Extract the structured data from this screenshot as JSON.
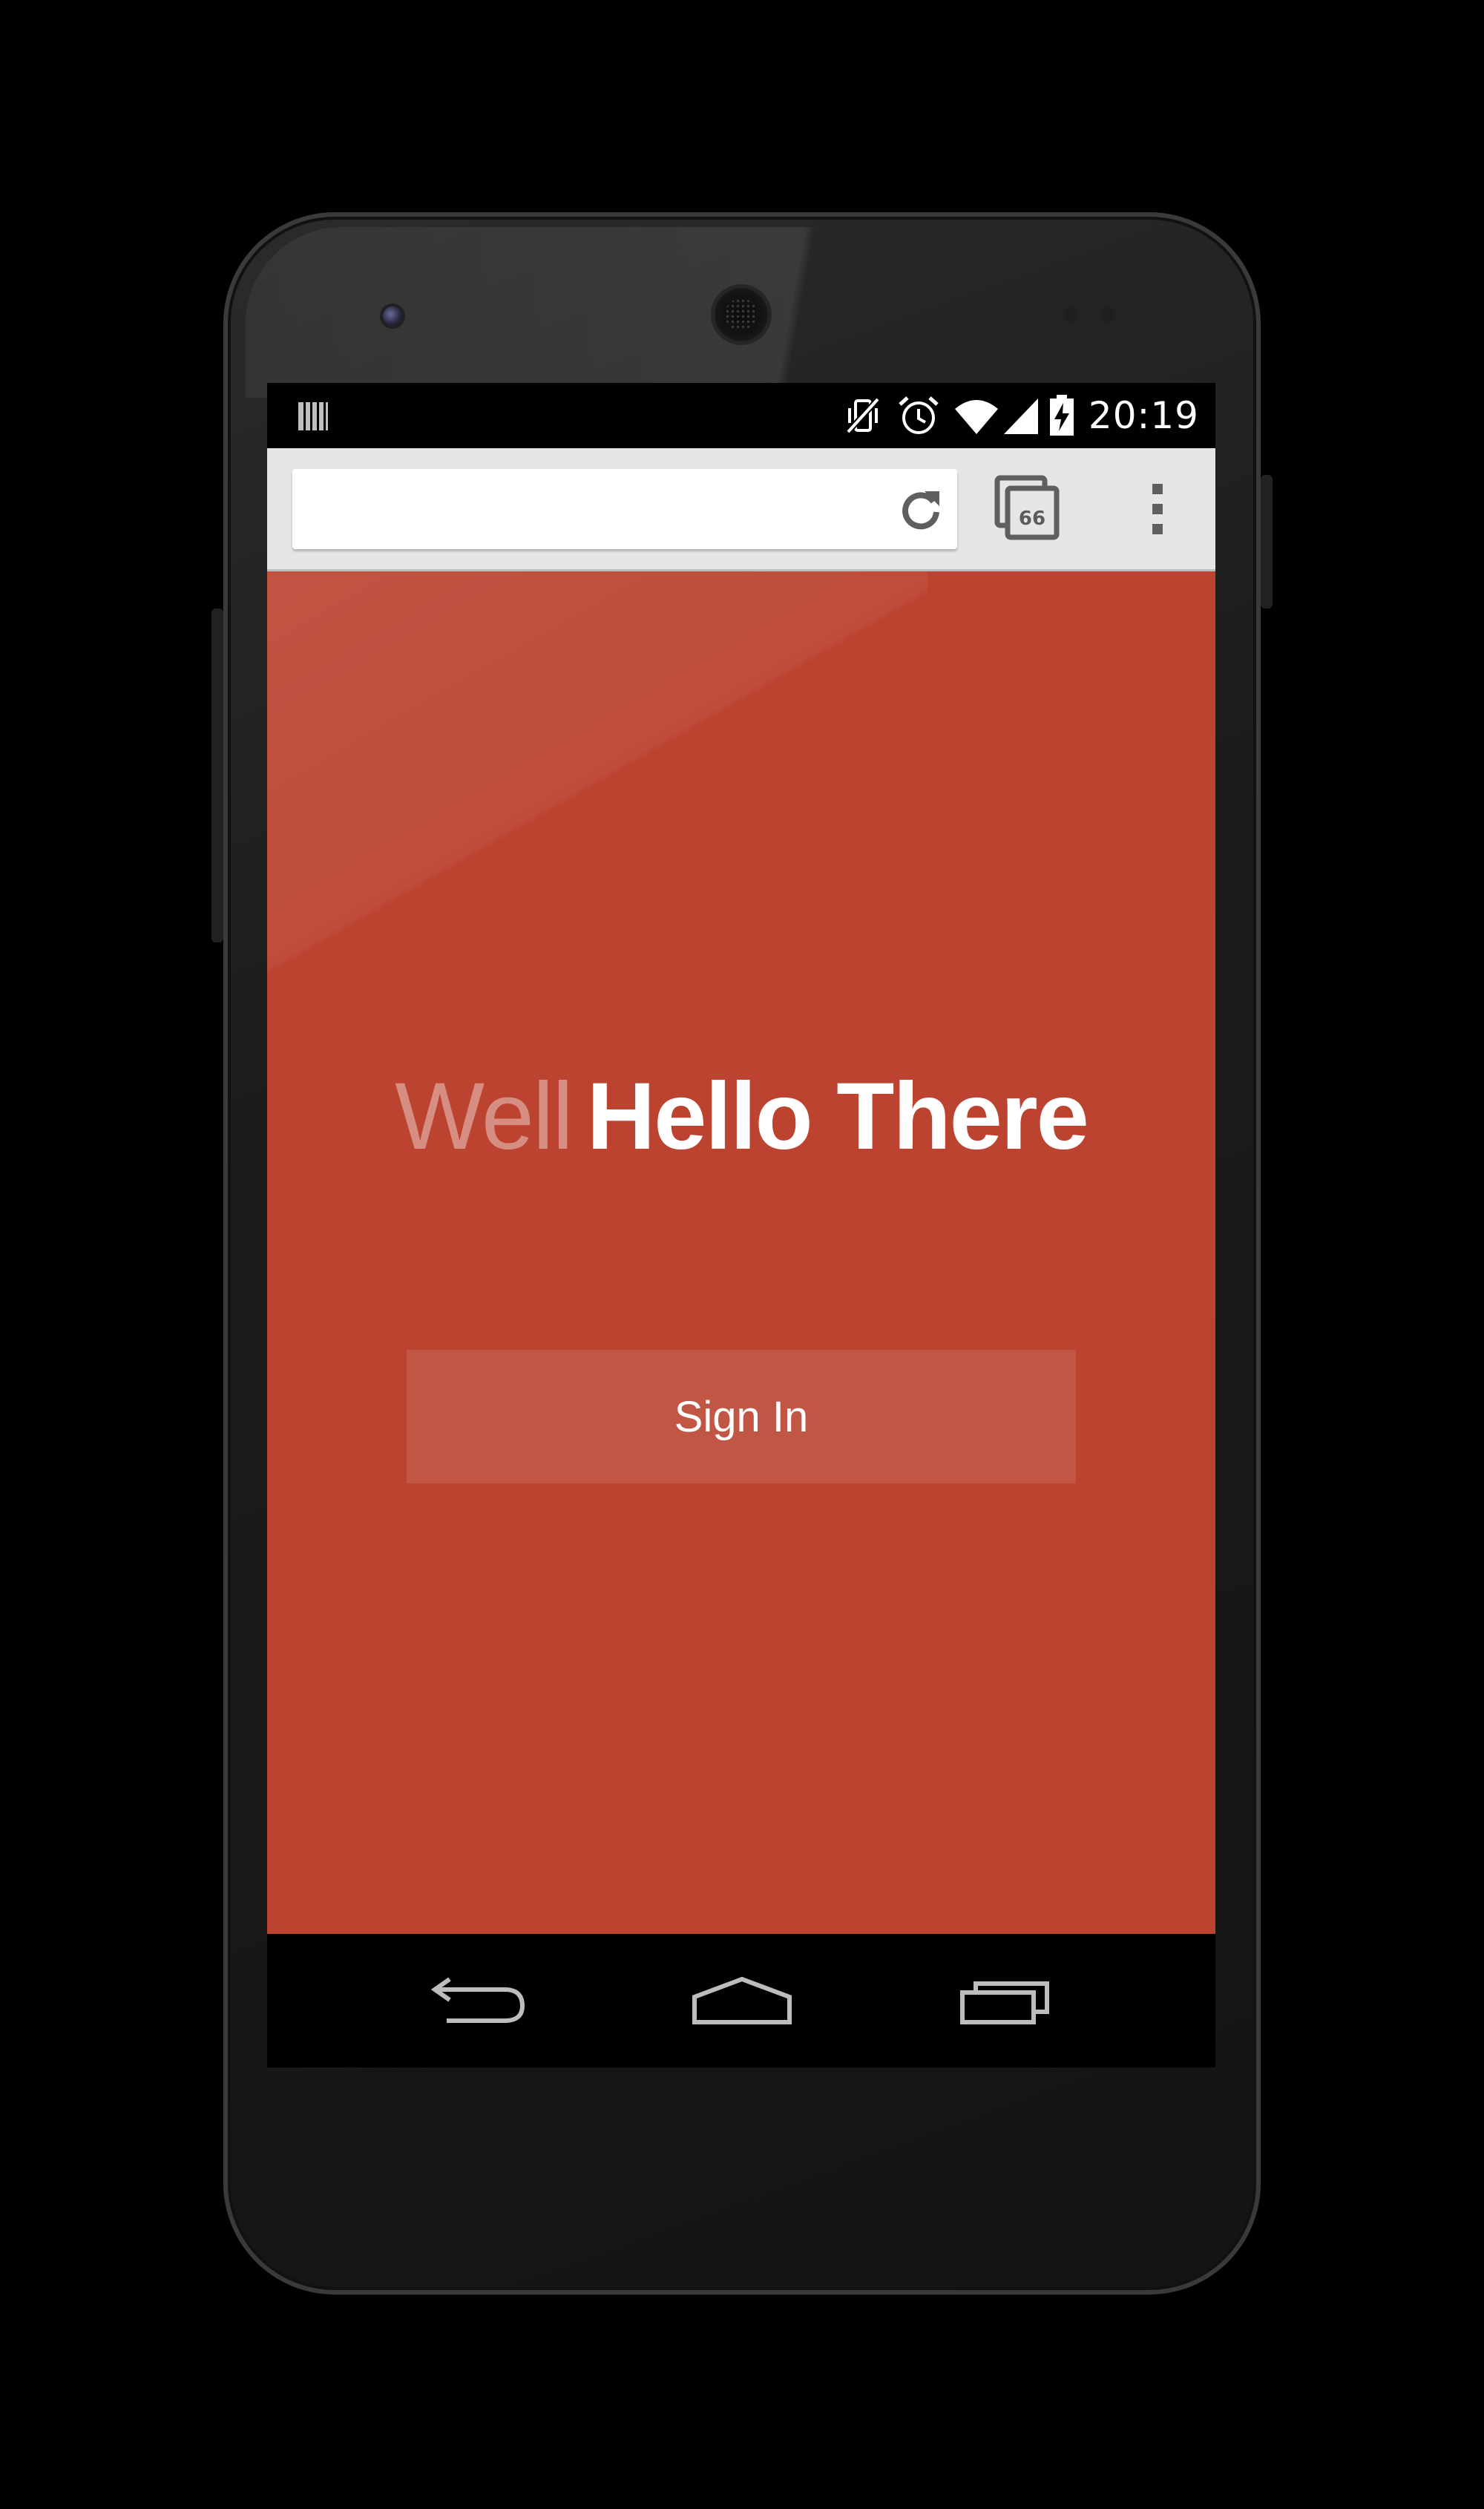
{
  "status_bar": {
    "time": "20:19",
    "icons": [
      "notification-bars-icon",
      "vibrate-mute-icon",
      "alarm-icon",
      "wifi-icon",
      "cell-signal-icon",
      "battery-charging-icon"
    ]
  },
  "browser": {
    "url_value": "",
    "tab_count": "66",
    "icons": [
      "reload-icon",
      "tabs-icon",
      "overflow-menu-icon"
    ]
  },
  "page": {
    "headline_light": "Well",
    "headline_bold": "Hello There",
    "signin_label": "Sign In",
    "background_color": "#bc4330"
  },
  "nav_bar": {
    "icons": [
      "back-icon",
      "home-icon",
      "recents-icon"
    ]
  }
}
